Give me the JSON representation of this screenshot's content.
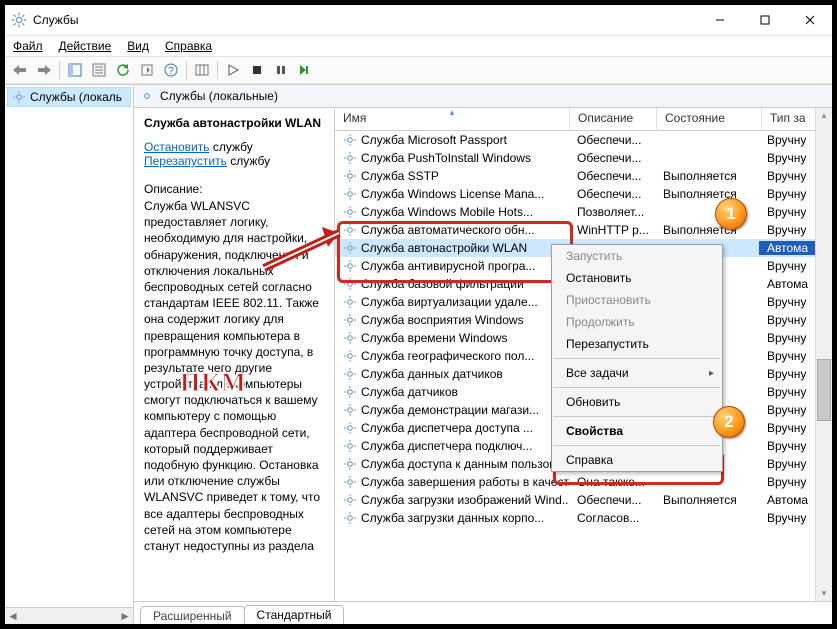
{
  "window": {
    "title": "Службы"
  },
  "menu": {
    "file": "Файл",
    "action": "Действие",
    "view": "Вид",
    "help": "Справка"
  },
  "tree": {
    "item": "Службы (локаль"
  },
  "right_header": "Службы (локальные)",
  "detail": {
    "title": "Служба автонастройки WLAN",
    "stop_link": "Остановить",
    "stop_tail": " службу",
    "restart_link": "Перезапустить",
    "restart_tail": " службу",
    "desc_label": "Описание:",
    "desc_text": "Служба WLANSVC предоставляет логику, необходимую для настройки, обнаружения, подключения и отключения локальных беспроводных сетей согласно стандартам IEEE 802.11. Также она содержит логику для превращения компьютера в программную точку доступа, в результате чего другие устройства или компьютеры смогут подключаться к вашему компьютеру с помощью адаптера беспроводной сети, который поддерживает подобную функцию. Остановка или отключение службы WLANSVC приведет к тому, что все адаптеры беспроводных сетей на этом компьютере станут недоступны из раздела"
  },
  "columns": {
    "name": "Имя",
    "desc": "Описание",
    "state": "Состояние",
    "type": "Тип за"
  },
  "services": [
    {
      "name": "Служба Microsoft Passport",
      "desc": "Обеспечи...",
      "state": "",
      "type": "Вручну"
    },
    {
      "name": "Служба PushToInstall Windows",
      "desc": "Обеспечи...",
      "state": "",
      "type": "Вручну"
    },
    {
      "name": "Служба SSTP",
      "desc": "Обеспечи...",
      "state": "Выполняется",
      "type": "Вручну"
    },
    {
      "name": "Служба Windows License Mana...",
      "desc": "Обеспечи...",
      "state": "Выполняется",
      "type": "Вручну"
    },
    {
      "name": "Служба Windows Mobile Hots...",
      "desc": "Позволяет...",
      "state": "",
      "type": "Вручну"
    },
    {
      "name": "Служба автоматического обн...",
      "desc": "WinHTTP р...",
      "state": "Выполняется",
      "type": "Вручну"
    },
    {
      "name": "Служба автонастройки WLAN",
      "desc": "",
      "state": "няется",
      "type": "Автома"
    },
    {
      "name": "Служба антивирусной програ...",
      "desc": "",
      "state": "",
      "type": "Вручну"
    },
    {
      "name": "Служба базовой фильтрации",
      "desc": "",
      "state": "",
      "type": "Автома"
    },
    {
      "name": "Служба виртуализации удале...",
      "desc": "",
      "state": "",
      "type": "Вручну"
    },
    {
      "name": "Служба восприятия Windows",
      "desc": "",
      "state": "",
      "type": "Вручну"
    },
    {
      "name": "Служба времени Windows",
      "desc": "",
      "state": "",
      "type": "Вручну"
    },
    {
      "name": "Служба географического пол...",
      "desc": "",
      "state": "няется",
      "type": "Вручну"
    },
    {
      "name": "Служба данных датчиков",
      "desc": "",
      "state": "",
      "type": "Вручну"
    },
    {
      "name": "Служба датчиков",
      "desc": "",
      "state": "",
      "type": "Вручну"
    },
    {
      "name": "Служба демонстрации магази...",
      "desc": "",
      "state": "",
      "type": "Вручну"
    },
    {
      "name": "Служба диспетчера доступа ...",
      "desc": "",
      "state": "",
      "type": "Вручну"
    },
    {
      "name": "Служба диспетчера подключ...",
      "desc": "",
      "state": "",
      "type": "Вручну"
    },
    {
      "name": "Служба доступа к данным пользов...",
      "desc": "",
      "state": "",
      "type": "Вручну"
    },
    {
      "name": "Служба завершения работы в качест...",
      "desc": "Она также...",
      "state": "",
      "type": "Вручну"
    },
    {
      "name": "Служба загрузки изображений Wind...",
      "desc": "Обеспечи...",
      "state": "Выполняется",
      "type": "Автома"
    },
    {
      "name": "Служба загрузки данных корпо...",
      "desc": "Согласов...",
      "state": "",
      "type": "Вручну"
    }
  ],
  "context_menu": {
    "start": "Запустить",
    "stop": "Остановить",
    "pause": "Приостановить",
    "resume": "Продолжить",
    "restart": "Перезапустить",
    "alltasks": "Все задачи",
    "refresh": "Обновить",
    "properties": "Свойства",
    "help": "Справка"
  },
  "tabs": {
    "ext": "Расширенный",
    "std": "Стандартный"
  },
  "overlay": {
    "pkm": "ПКМ"
  }
}
